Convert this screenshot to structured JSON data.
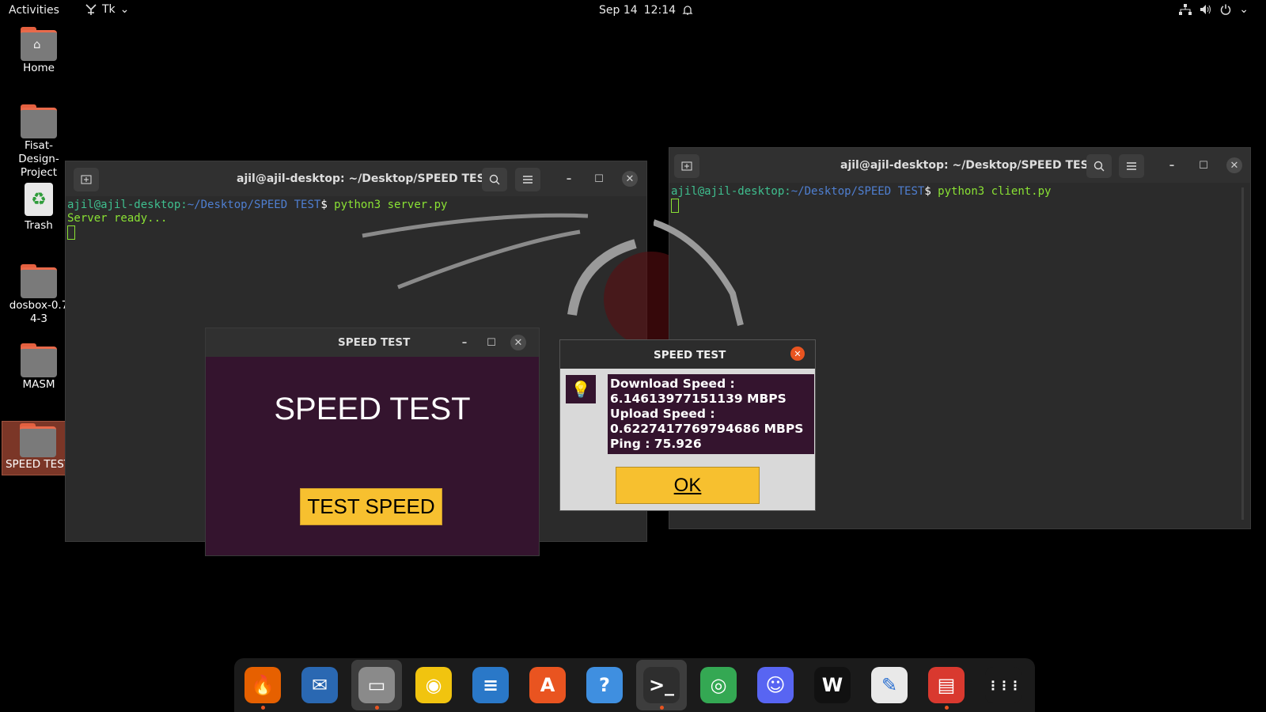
{
  "topbar": {
    "activities": "Activities",
    "app_name": "Tk",
    "date": "Sep 14",
    "time": "12:14"
  },
  "desktop_icons": [
    {
      "label": "Home"
    },
    {
      "label": "Fisat-Design-Project"
    },
    {
      "label": "Trash"
    },
    {
      "label": "dosbox-0.74-3"
    },
    {
      "label": "MASM"
    },
    {
      "label": "SPEED TEST"
    }
  ],
  "terminal_left": {
    "title": "ajil@ajil-desktop: ~/Desktop/SPEED TEST",
    "prompt_user": "ajil@ajil-desktop",
    "prompt_path": "~/Desktop/SPEED TEST",
    "prompt_symbol": "$",
    "command": " python3 server.py",
    "output": "Server ready..."
  },
  "terminal_right": {
    "title": "ajil@ajil-desktop: ~/Desktop/SPEED TEST",
    "prompt_user": "ajil@ajil-desktop",
    "prompt_path": "~/Desktop/SPEED TEST",
    "prompt_symbol": "$",
    "command": " python3 client.py"
  },
  "tk_window": {
    "title": "SPEED TEST",
    "heading": "SPEED TEST",
    "button": "TEST SPEED"
  },
  "message_dialog": {
    "title": "SPEED TEST",
    "lines": [
      "Download Speed :",
      "6.14613977151139 MBPS",
      "Upload Speed :",
      "0.6227417769794686 MBPS",
      "Ping : 75.926"
    ],
    "ok_label": "OK"
  },
  "dock": {
    "items": [
      {
        "name": "firefox",
        "color": "#e66000",
        "glyph": "🔥",
        "running": true
      },
      {
        "name": "thunderbird",
        "color": "#2a68b2",
        "glyph": "✉",
        "running": false
      },
      {
        "name": "files",
        "color": "#8a8a8a",
        "glyph": "▭",
        "running": true
      },
      {
        "name": "rhythmbox",
        "color": "#f1c40f",
        "glyph": "◉",
        "running": false
      },
      {
        "name": "libreoffice-writer",
        "color": "#2a78c8",
        "glyph": "≡",
        "running": false
      },
      {
        "name": "app-center",
        "color": "#e95420",
        "glyph": "A",
        "running": false
      },
      {
        "name": "help",
        "color": "#3f8fe0",
        "glyph": "?",
        "running": false
      },
      {
        "name": "terminal",
        "color": "#2e2e2e",
        "glyph": ">_",
        "running": true
      },
      {
        "name": "chrome",
        "color": "#34a853",
        "glyph": "◎",
        "running": false
      },
      {
        "name": "discord",
        "color": "#5865f2",
        "glyph": "☺",
        "running": false
      },
      {
        "name": "webex",
        "color": "#111111",
        "glyph": "W",
        "running": false
      },
      {
        "name": "text-editor",
        "color": "#e9e9e9",
        "glyph": "✎",
        "running": false
      },
      {
        "name": "document-viewer",
        "color": "#d9392f",
        "glyph": "▤",
        "running": true
      },
      {
        "name": "show-applications",
        "color": "#1b1b1b",
        "glyph": "⋮⋮⋮",
        "running": false
      }
    ]
  }
}
